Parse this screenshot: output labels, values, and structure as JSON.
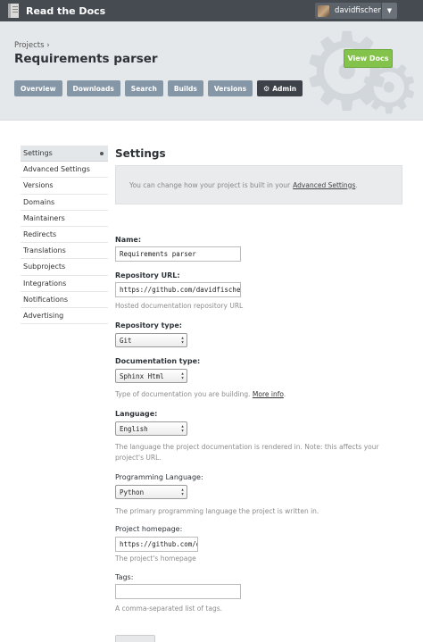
{
  "app": {
    "title": "Read the Docs"
  },
  "user": {
    "name": "davidfischer",
    "dropdown_glyph": "▼"
  },
  "project": {
    "breadcrumb": "Projects ›",
    "name": "Requirements parser",
    "view_docs_label": "View Docs"
  },
  "tabs": [
    {
      "label": "Overview"
    },
    {
      "label": "Downloads"
    },
    {
      "label": "Search"
    },
    {
      "label": "Builds"
    },
    {
      "label": "Versions"
    },
    {
      "label": "Admin",
      "active": true
    }
  ],
  "sidebar": {
    "items": [
      {
        "label": "Settings",
        "active": true
      },
      {
        "label": "Advanced Settings"
      },
      {
        "label": "Versions"
      },
      {
        "label": "Domains"
      },
      {
        "label": "Maintainers"
      },
      {
        "label": "Redirects"
      },
      {
        "label": "Translations"
      },
      {
        "label": "Subprojects"
      },
      {
        "label": "Integrations"
      },
      {
        "label": "Notifications"
      },
      {
        "label": "Advertising"
      }
    ]
  },
  "main": {
    "title": "Settings",
    "info": {
      "prefix": "You can change how your project is built in your",
      "link": "Advanced Settings",
      "suffix": "."
    },
    "form": {
      "name": {
        "label": "Name:",
        "value": "Requirements parser"
      },
      "repo_url": {
        "label": "Repository URL:",
        "value": "https://github.com/davidfischer/requirements-parser",
        "help": "Hosted documentation repository URL"
      },
      "repo_type": {
        "label": "Repository type:",
        "value": "Git"
      },
      "doc_type": {
        "label": "Documentation type:",
        "value": "Sphinx Html",
        "help": "Type of documentation you are building.",
        "help_link": "More info"
      },
      "language": {
        "label": "Language:",
        "value": "English",
        "help": "The language the project documentation is rendered in. Note: this affects your project's URL."
      },
      "prog_language": {
        "label": "Programming Language:",
        "value": "Python",
        "help": "The primary programming language the project is written in."
      },
      "homepage": {
        "label": "Project homepage:",
        "value": "https://github.com/davidfischer/requirements-parser",
        "help": "The project's homepage"
      },
      "tags": {
        "label": "Tags:",
        "value": "",
        "help": "A comma-separated list of tags."
      }
    }
  },
  "colors": {
    "topbar": "#464b52",
    "header_bg": "#e5e8eb",
    "tab": "#8596a6",
    "tab_active": "#3c4248",
    "view_docs": "#83c34c"
  }
}
